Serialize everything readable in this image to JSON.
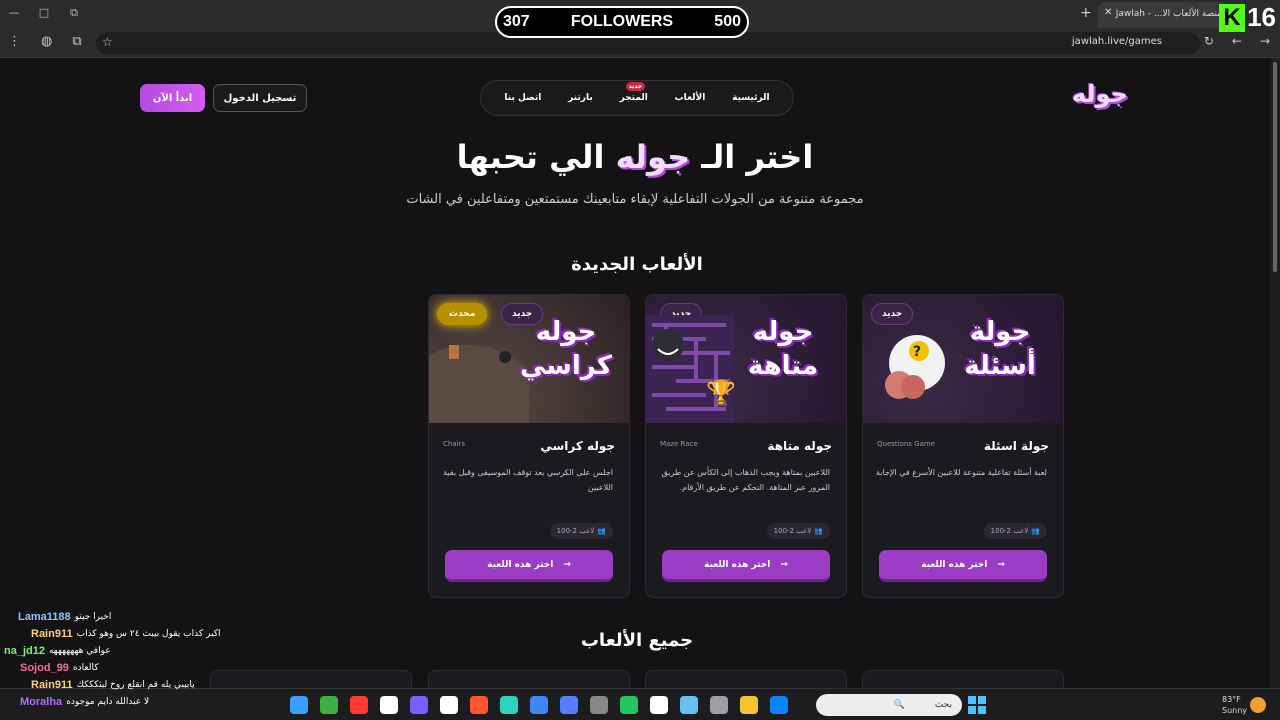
{
  "browser": {
    "tab_title": "منصة الألعاب الا... - Jawlah",
    "url": "jawlah.live/games",
    "win_buttons": [
      "—",
      "□",
      "⧉"
    ],
    "tab_close": "✕",
    "new_tab": "+"
  },
  "overlay": {
    "followers_left": "307",
    "followers_label": "FOLLOWERS",
    "followers_right": "500",
    "kick_letter": "K",
    "kick_count": "16"
  },
  "site": {
    "logo": "جوله",
    "start_button": "ابدأ الآن",
    "login_button": "تسجيل الدخول",
    "nav": [
      {
        "label": "الرئيسية"
      },
      {
        "label": "الألعاب"
      },
      {
        "label": "المتجر",
        "badge": "جديد"
      },
      {
        "label": "بارتنر"
      },
      {
        "label": "اتصل بنا"
      }
    ],
    "hero_title_pre": "اختر الـ",
    "hero_title_highlight": "جوله",
    "hero_title_post": "الي تحبها",
    "hero_subtitle": "مجموعة متنوعة من الجولات التفاعلية لإبقاء متابعينك مستمتعين ومتفاعلين في الشات",
    "new_games_title": "الألعاب الجديدة",
    "all_games_title": "جميع الألعاب"
  },
  "cards": [
    {
      "image_title": "جولة أسئلة",
      "badge": "جديد",
      "name": "جولة اسئلة",
      "tag": "Questions Game",
      "desc": "لعبة أسئلة تفاعلية متنوعة للاعبين الأسرع في الإجابة",
      "players": "100-2 لاعب",
      "button": "اختر هذه اللعبة",
      "arrow": "→"
    },
    {
      "image_title": "جوله متاهة",
      "badge": "جديد",
      "name": "جوله متاهة",
      "tag": "Maze Race",
      "desc": "اللاعبين بمتاهة ويجب الذهاب إلى الكأس عن طريق المرور عبر المتاهة. التحكم عن طريق الأرقام.",
      "players": "100-2 لاعب",
      "button": "اختر هذه اللعبة",
      "arrow": "→"
    },
    {
      "image_title": "جوله كراسي",
      "badge": "جديد",
      "updated": "محدث",
      "name": "جوله كراسي",
      "tag": "Chairs",
      "desc": "اجلس على الكرسي بعد توقف الموسيقى وقبل بقية اللاعبين",
      "players": "100-2 لاعب",
      "button": "اختر هذه اللعبة",
      "arrow": "→"
    }
  ],
  "chat": [
    {
      "name": "Lama1188",
      "msg": "اخيرا جيتو",
      "color": "#8fc4ff"
    },
    {
      "name": "Rain911",
      "msg": "اكبر كذاب يقول بيبث ٢٤ س وهو كذاب",
      "color": "#ffd27a"
    },
    {
      "name": "na_jd12",
      "msg": "عوافي هههههههه",
      "color": "#7cf27c"
    },
    {
      "name": "Sojod_99",
      "msg": "كالعاده",
      "color": "#ff6a9a"
    },
    {
      "name": "Rain911",
      "msg": "يابيبي يله قم انقلع روح لبثكككك",
      "color": "#ffd27a"
    },
    {
      "name": "Moralha",
      "msg": "لا عبدالله دايم موجوده",
      "color": "#b06aff"
    }
  ],
  "taskbar": {
    "search_placeholder": "بحث",
    "temp": "83°F",
    "weather": "Sunny",
    "colors": [
      "#3aa0ff",
      "#3cb043",
      "#ff3b30",
      "#ffffff",
      "#7a5cff",
      "#ffffff",
      "#ff5533",
      "#2ed3b7",
      "#4285f4",
      "#5a7dff",
      "#888888",
      "#22c55e",
      "#ffffff",
      "#66c0f4",
      "#9aa0a6",
      "#f4c430",
      "#0a84ff"
    ]
  }
}
